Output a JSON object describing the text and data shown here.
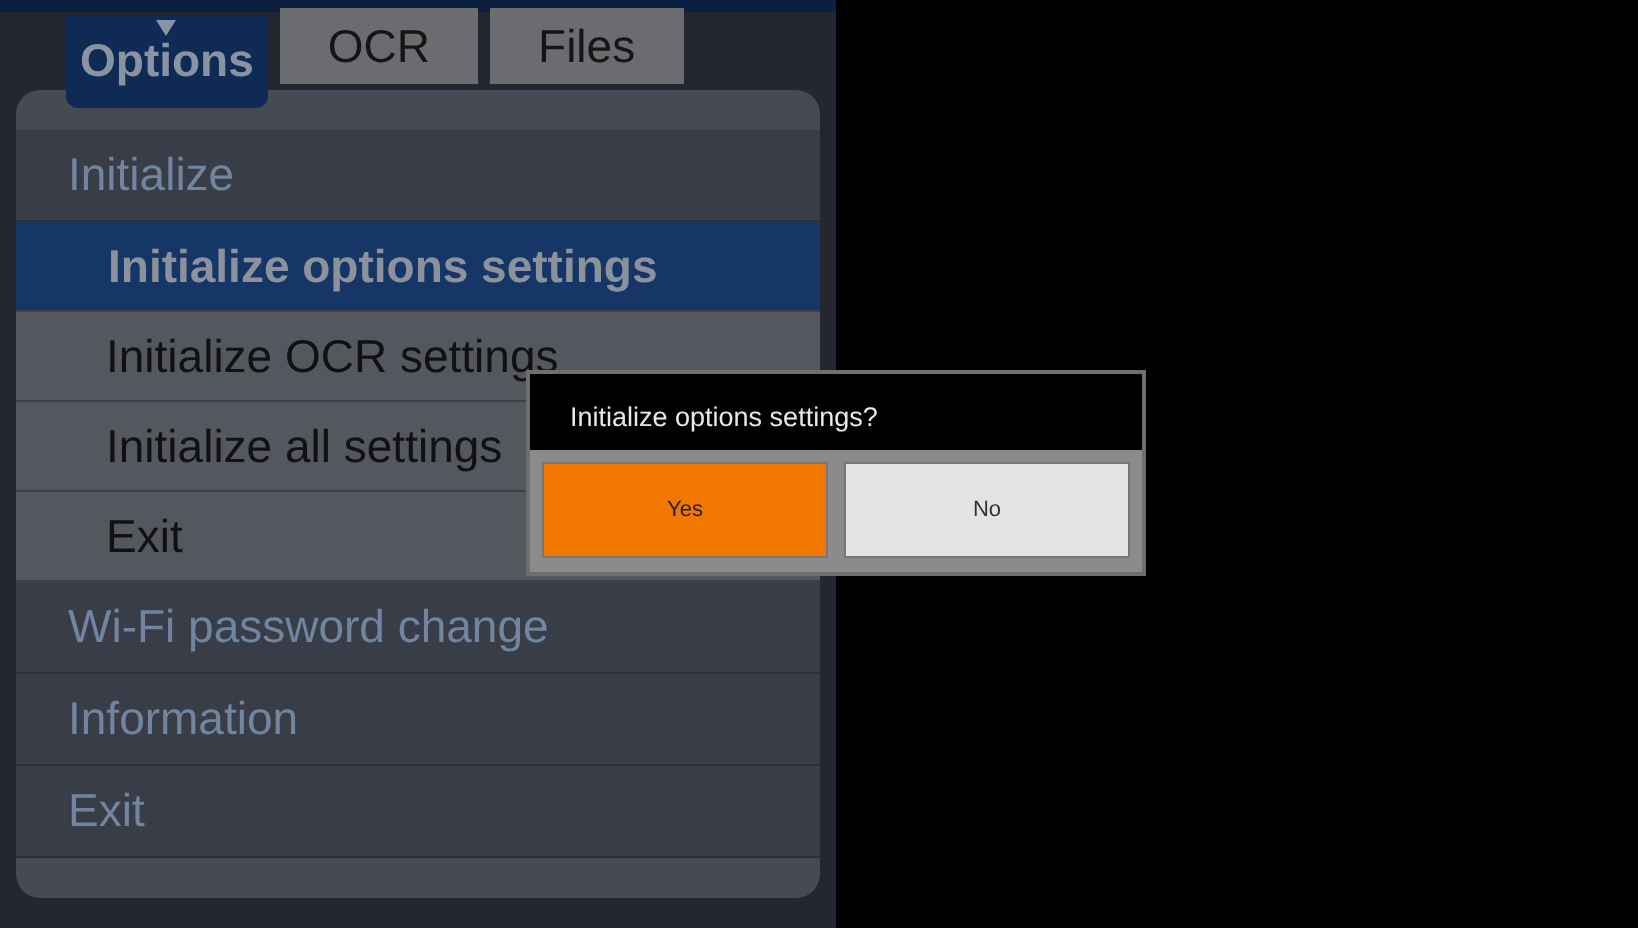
{
  "tabs": [
    {
      "label": "Options",
      "selected": true
    },
    {
      "label": "OCR",
      "selected": false
    },
    {
      "label": "Files",
      "selected": false
    }
  ],
  "menu": [
    {
      "kind": "section",
      "label": "Initialize",
      "children": [
        {
          "label": "Initialize options settings",
          "selected": true
        },
        {
          "label": "Initialize OCR settings",
          "selected": false
        },
        {
          "label": "Initialize all settings",
          "selected": false
        },
        {
          "label": "Exit",
          "selected": false
        }
      ]
    },
    {
      "kind": "section",
      "label": "Wi-Fi password change"
    },
    {
      "kind": "section",
      "label": "Information"
    },
    {
      "kind": "section",
      "label": "Exit"
    }
  ],
  "dialog": {
    "message": "Initialize options settings?",
    "buttons": [
      {
        "label": "Yes",
        "selected": true
      },
      {
        "label": "No",
        "selected": false
      }
    ]
  }
}
